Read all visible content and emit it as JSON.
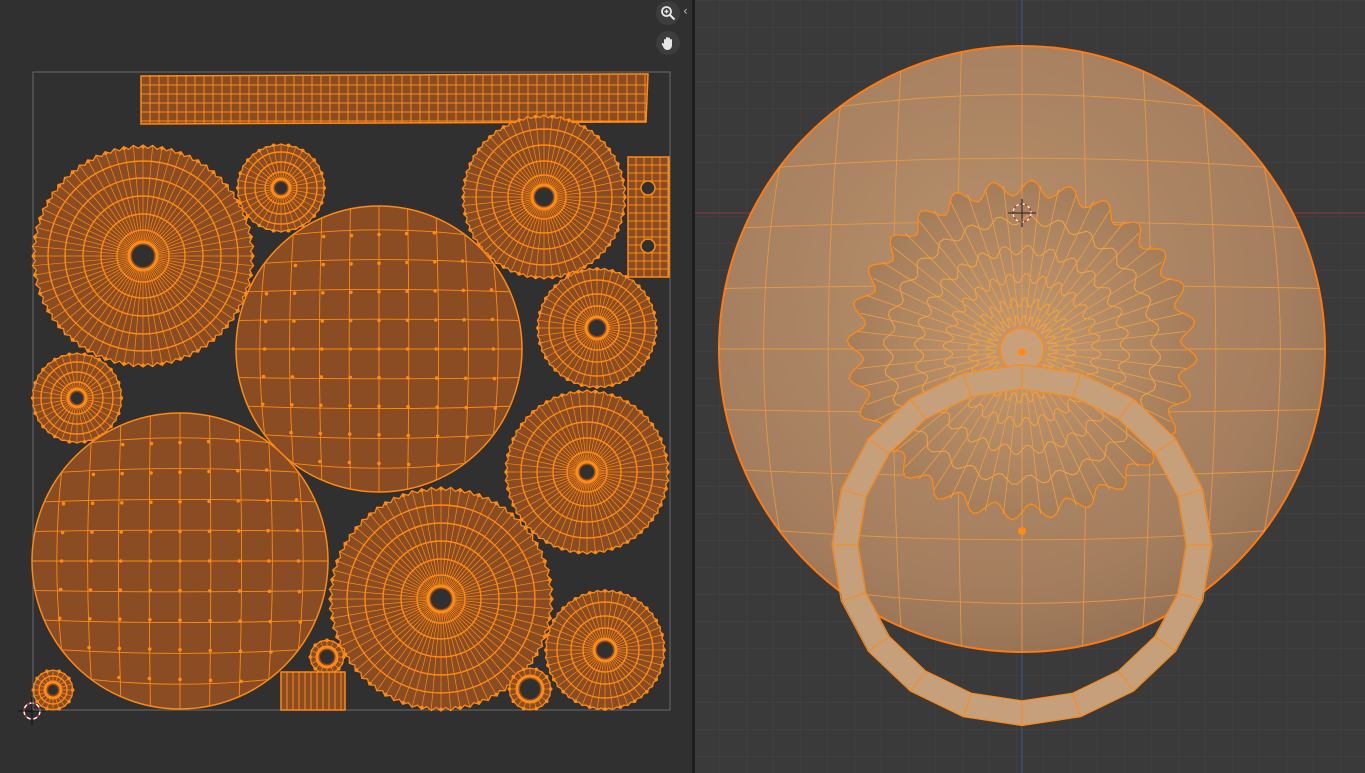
{
  "uv_editor": {
    "tools": [
      {
        "name": "zoom",
        "icon": "zoom-magnifier-icon"
      },
      {
        "name": "pan",
        "icon": "hand-pan-icon"
      }
    ],
    "collapse_icon": "chevron-left-icon",
    "collapse_glyph": "‹"
  },
  "viewport_3d": {
    "grid": true,
    "cursor_icon": "3d-cursor-icon"
  },
  "colors": {
    "selection_orange": "#ff8a14",
    "uv_face_fill": "#8a4c22",
    "panel_background": "#303030",
    "viewport_background": "#3a3a3a",
    "grid_line": "#464646",
    "x_axis": "#8a3a3a",
    "y_axis": "#3a5a8a"
  }
}
